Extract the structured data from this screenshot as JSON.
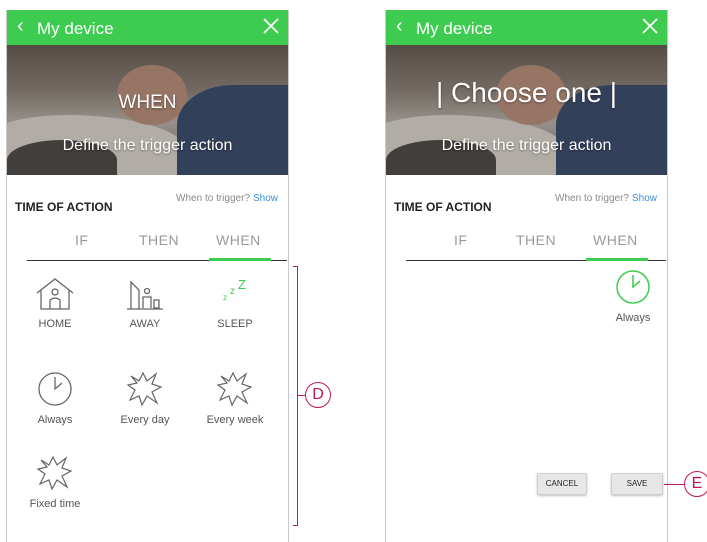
{
  "screens": [
    {
      "header": {
        "title": "My device"
      },
      "hero": {
        "title": "WHEN",
        "subtitle": "Define the trigger action"
      },
      "section": {
        "title": "TIME OF ACTION",
        "trigger_prompt": "When to trigger?",
        "show_link": "Show"
      },
      "tabs": [
        "IF",
        "THEN",
        "WHEN"
      ],
      "active_tab": "WHEN",
      "options": [
        "HOME",
        "AWAY",
        "SLEEP",
        "Always",
        "Every day",
        "Every week",
        "Fixed time"
      ]
    },
    {
      "header": {
        "title": "My device"
      },
      "hero": {
        "title": "| Choose one |",
        "subtitle": "Define the trigger action"
      },
      "section": {
        "title": "TIME OF ACTION",
        "trigger_prompt": "When to trigger?",
        "show_link": "Show"
      },
      "tabs": [
        "IF",
        "THEN",
        "WHEN"
      ],
      "active_tab": "WHEN",
      "options": [
        "Always"
      ],
      "buttons": {
        "cancel": "CANCEL",
        "save": "SAVE"
      }
    }
  ],
  "callouts": {
    "d": "D",
    "e": "E"
  },
  "colors": {
    "header_green": "#3dcc4f",
    "accent_magenta": "#c2185b",
    "link_blue": "#3a8fd8"
  },
  "icons": [
    "chevron-left-icon",
    "close-icon",
    "home-icon",
    "away-icon",
    "sleep-icon",
    "clock-icon",
    "burst-icon"
  ]
}
